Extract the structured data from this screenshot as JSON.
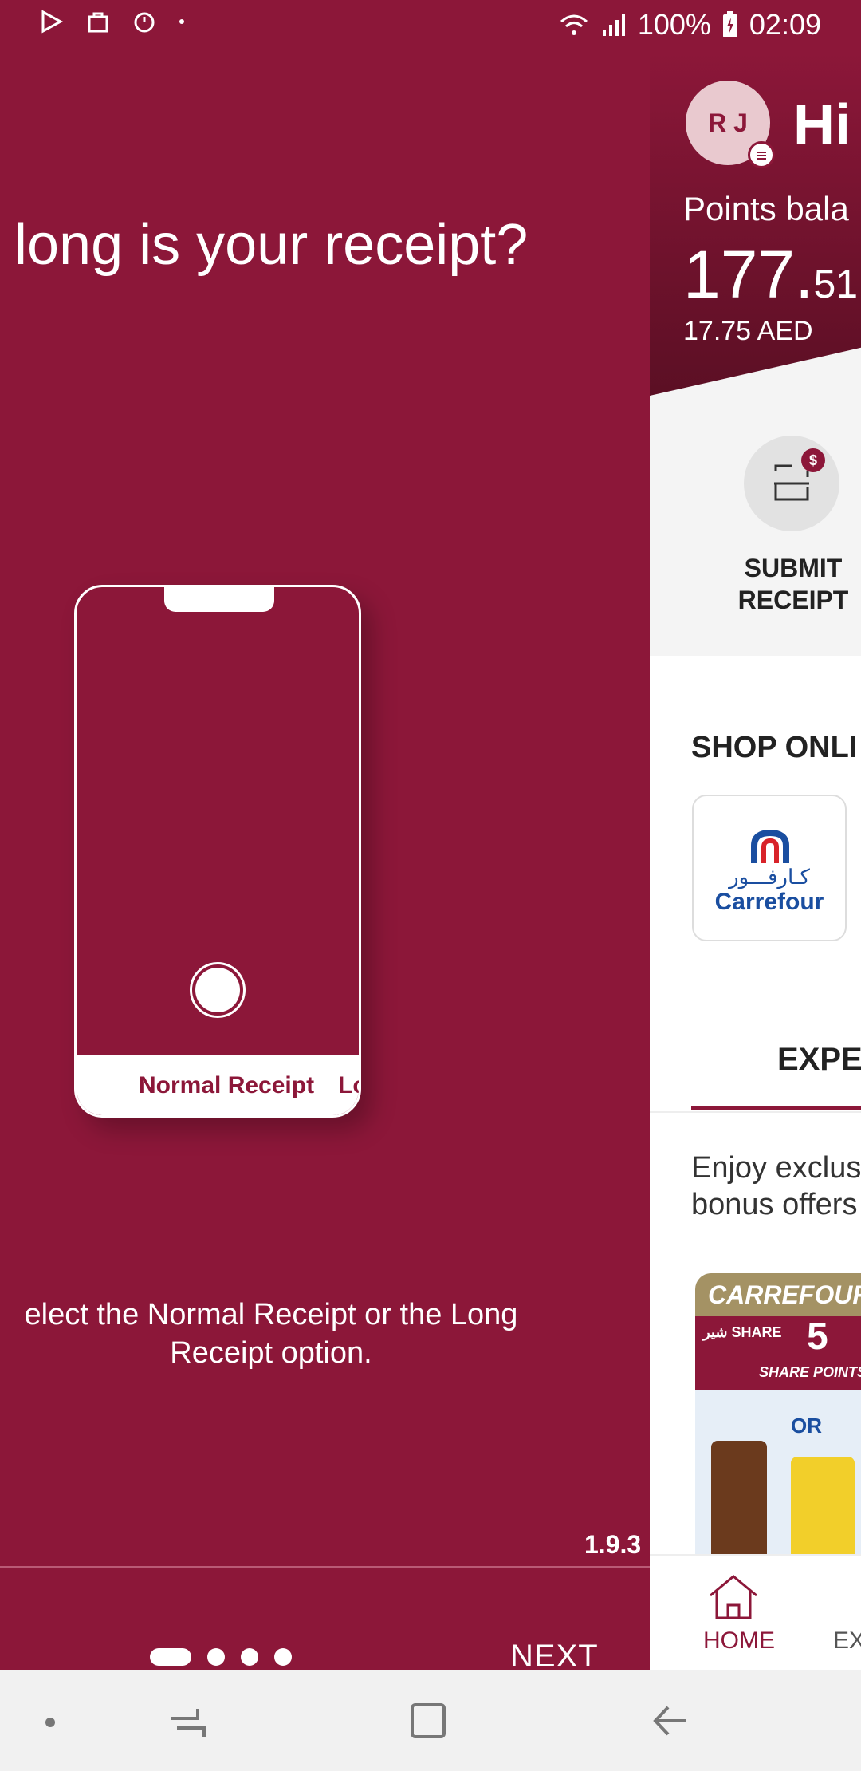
{
  "status_bar": {
    "battery": "100%",
    "time": "02:09",
    "icons": [
      "play-store-icon",
      "shopping-bag-icon",
      "timer-icon",
      "dot-icon",
      "wifi-icon",
      "signal-icon",
      "battery-icon"
    ]
  },
  "onboarding": {
    "question": "long is your receipt?",
    "phone_tab_normal": "Normal Receipt",
    "phone_tab_long": "Lo",
    "instruction": "elect the Normal Receipt or the Long Receipt option.",
    "version": "1.9.3",
    "next_label": "NEXT",
    "dots_total": 4,
    "dots_active_index": 0
  },
  "home": {
    "avatar_initials": "R J",
    "greeting": "Hi",
    "points_label": "Points bala",
    "points_value_main": "177.",
    "points_value_decimal": "51",
    "points_aed": "17.75 AED",
    "submit_label_line1": "SUBMIT",
    "submit_label_line2": "RECEIPT",
    "shop_online_title": "SHOP ONLI",
    "store_arabic": "كـارفـــور",
    "store_name": "Carrefour",
    "tab_title": "EXPE",
    "offer_text_line1": "Enjoy exclus",
    "offer_text_line2": "bonus offers",
    "offer_tag": "CARREFOUR",
    "offer_share_logo": "شير SHARE",
    "offer_share_number": "5",
    "offer_share_points": "SHARE POINTS",
    "offer_or": "OR",
    "nav_home": "HOME",
    "nav_ex": "EX"
  },
  "colors": {
    "brand": "#8c1739",
    "gold": "#a49264",
    "carrefour_blue": "#1a4ea0"
  }
}
